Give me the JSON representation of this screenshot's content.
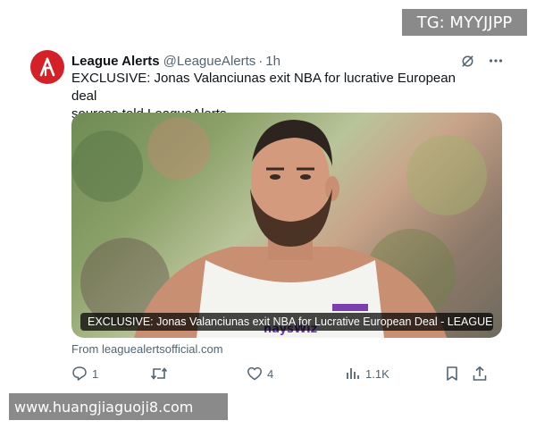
{
  "watermarks": {
    "top": "TG: MYYJJPP",
    "bottom": "www.huangjiaguoji8.com"
  },
  "tweet": {
    "author_name": "League Alerts",
    "author_handle": "@LeagueAlerts",
    "separator": "·",
    "time": "1h",
    "text_line1": "EXCLUSIVE: Jonas Valanciunas exit NBA for lucrative European deal",
    "text_line2": "sources told LeagueAlerts",
    "media_caption": "EXCLUSIVE: Jonas Valanciunas exit NBA for Lucrative European Deal - LEAGUE...",
    "jersey_text": "naysWiz",
    "source_link": "From leaguealertsofficial.com"
  },
  "actions": {
    "replies": "1",
    "retweets": "",
    "likes": "4",
    "views": "1.1K"
  },
  "colors": {
    "avatar": "#d42027",
    "text_primary": "#0f1419",
    "text_secondary": "#536471"
  },
  "icons": {
    "avatar_logo": "league-alerts-logo",
    "grok": "grok-icon",
    "more": "more-icon",
    "reply": "reply-icon",
    "retweet": "retweet-icon",
    "like": "like-icon",
    "views": "views-icon",
    "bookmark": "bookmark-icon",
    "share": "share-icon"
  }
}
